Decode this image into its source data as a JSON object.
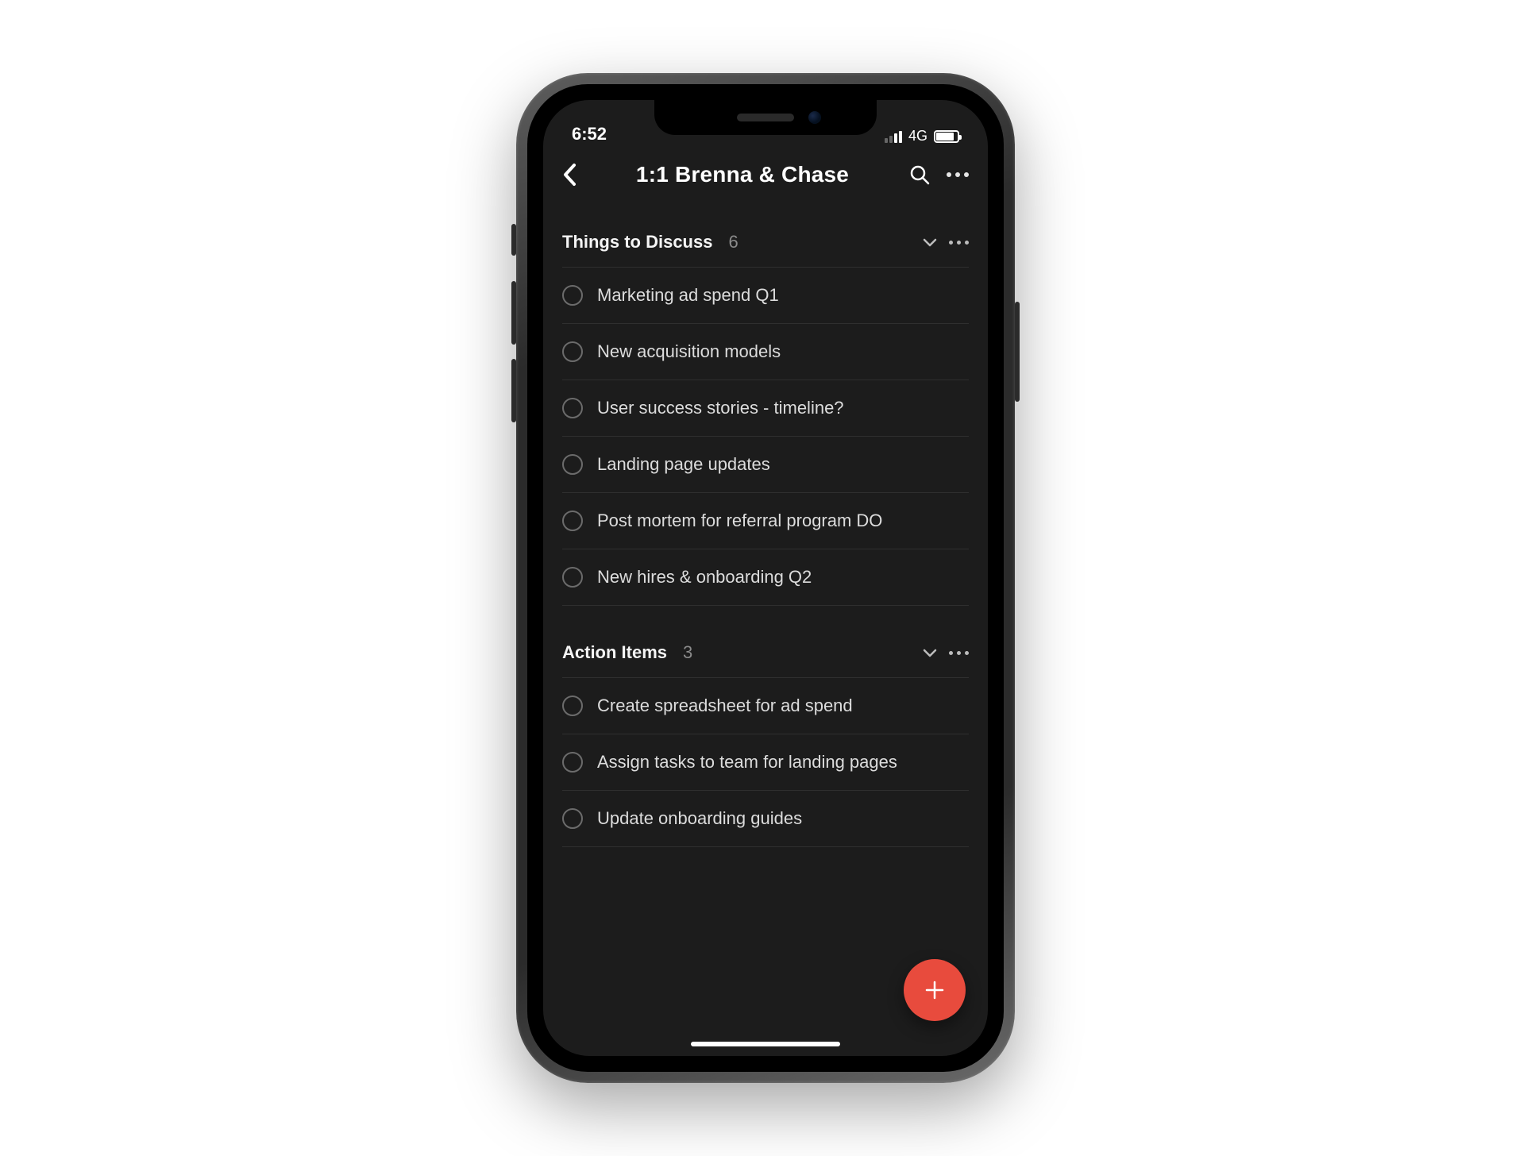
{
  "status": {
    "time": "6:52",
    "network": "4G"
  },
  "header": {
    "title": "1:1 Brenna & Chase"
  },
  "sections": [
    {
      "title": "Things to Discuss",
      "count": "6",
      "items": [
        "Marketing ad spend Q1",
        "New acquisition models",
        "User success stories - timeline?",
        "Landing page updates",
        "Post mortem for referral program DO",
        "New hires & onboarding Q2"
      ]
    },
    {
      "title": "Action Items",
      "count": "3",
      "items": [
        "Create spreadsheet for ad spend",
        "Assign tasks to team for landing pages",
        "Update onboarding guides"
      ]
    }
  ],
  "fab_color": "#e84b3d"
}
